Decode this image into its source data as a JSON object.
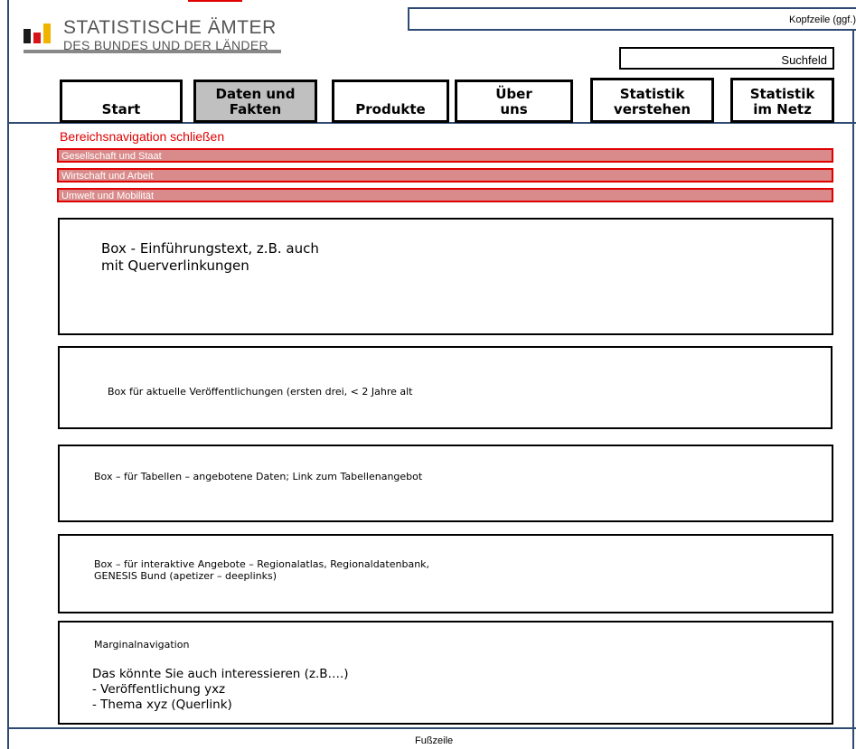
{
  "header": {
    "logo_title": "STATISTISCHE ÄMTER",
    "logo_subtitle": "DES BUNDES UND DER LÄNDER",
    "logo_colors": [
      "#1a1a1a",
      "#d7141a",
      "#f0b400"
    ],
    "kopfzeile": "Kopfzeile (ggf.)",
    "suchfeld": "Suchfeld"
  },
  "nav": {
    "items": [
      {
        "label": "Start"
      },
      {
        "label": "Daten und Fakten",
        "active": true
      },
      {
        "label": "Produkte"
      },
      {
        "label": "Über uns"
      },
      {
        "label": "Statistik verstehen"
      },
      {
        "label": "Statistik im Netz"
      }
    ]
  },
  "area_nav": {
    "close_label": "Bereichsnavigation schließen",
    "items": [
      "Gesellschaft und Staat",
      "Wirtschaft und Arbeit",
      "Umwelt und Mobilität"
    ]
  },
  "boxes": {
    "intro": {
      "line1": "Box - Einführungstext, z.B. auch",
      "line2": "mit Querverlinkungen"
    },
    "publications": "Box für aktuelle Veröffentlichungen (ersten drei, < 2 Jahre alt",
    "tables": "Box – für Tabellen – angebotene Daten; Link zum Tabellenangebot",
    "interactive": {
      "line1": "Box – für interaktive Angebote – Regionalatlas, Regionaldatenbank,",
      "line2": "GENESIS Bund (apetizer – deeplinks)"
    },
    "marginal": {
      "heading": "Marginalnavigation",
      "lead": "Das könnte Sie auch interessieren (z.B….)",
      "items": [
        "-  Veröffentlichung yxz",
        "-  Thema xyz (Querlink)"
      ]
    }
  },
  "footer": "Fußzeile"
}
